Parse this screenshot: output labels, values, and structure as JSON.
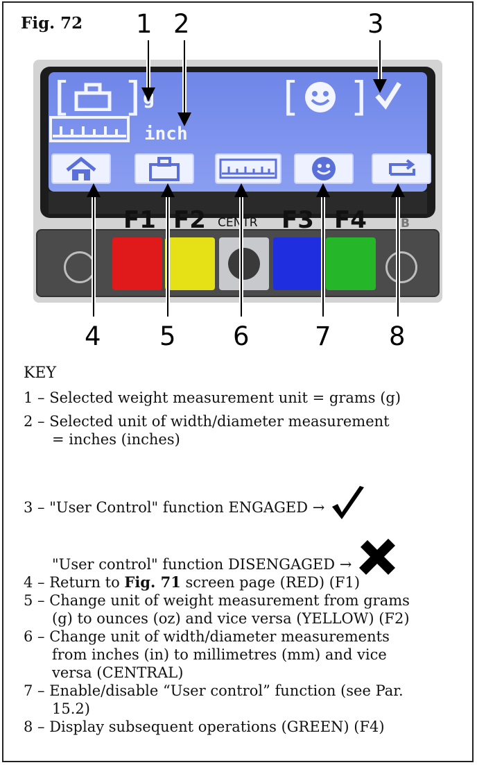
{
  "figure": {
    "label": "Fig. 72"
  },
  "callouts_top": [
    "1",
    "2",
    "3"
  ],
  "callouts_bottom": [
    "4",
    "5",
    "6",
    "7",
    "8"
  ],
  "display": {
    "weight_unit": "g",
    "width_unit": "inch",
    "fkey_labels": [
      "F1",
      "F2",
      "CENTR",
      "F3",
      "F4",
      "B"
    ]
  },
  "buttons": {
    "colors": [
      "#e01a1a",
      "#e6e017",
      "#c7c9cc",
      "#1f2fe0",
      "#26b62a"
    ],
    "icons": [
      "home-icon",
      "weight-icon",
      "ruler-icon",
      "smiley-icon",
      "next-icon"
    ]
  },
  "key": {
    "title": "KEY",
    "items": [
      {
        "lines": [
          "1 – Selected weight measurement unit = grams (g)"
        ]
      },
      {
        "lines": [
          "2 – Selected unit of width/diameter measurement",
          "= inches (inches)"
        ]
      },
      {
        "lines": [
          "3 – \"User Control\" function ENGAGED →"
        ]
      },
      {
        "lines": [
          "\"User control\" function DISENGAGED →"
        ]
      },
      {
        "prefix": "4 – Return to ",
        "bold": "Fig. 71",
        "suffix": " screen page (RED) (F1)"
      },
      {
        "lines": [
          "5 – Change unit of weight measurement from grams",
          "(g) to ounces (oz) and vice versa (YELLOW) (F2)"
        ]
      },
      {
        "lines": [
          "6 – Change unit of width/diameter measurements",
          "from inches (in) to millimetres (mm) and vice",
          "versa (CENTRAL)"
        ]
      },
      {
        "lines": [
          "7 – Enable/disable “User control” function (see Par.",
          "15.2)"
        ]
      },
      {
        "lines": [
          "8 – Display subsequent operations (GREEN) (F4)"
        ]
      }
    ]
  }
}
